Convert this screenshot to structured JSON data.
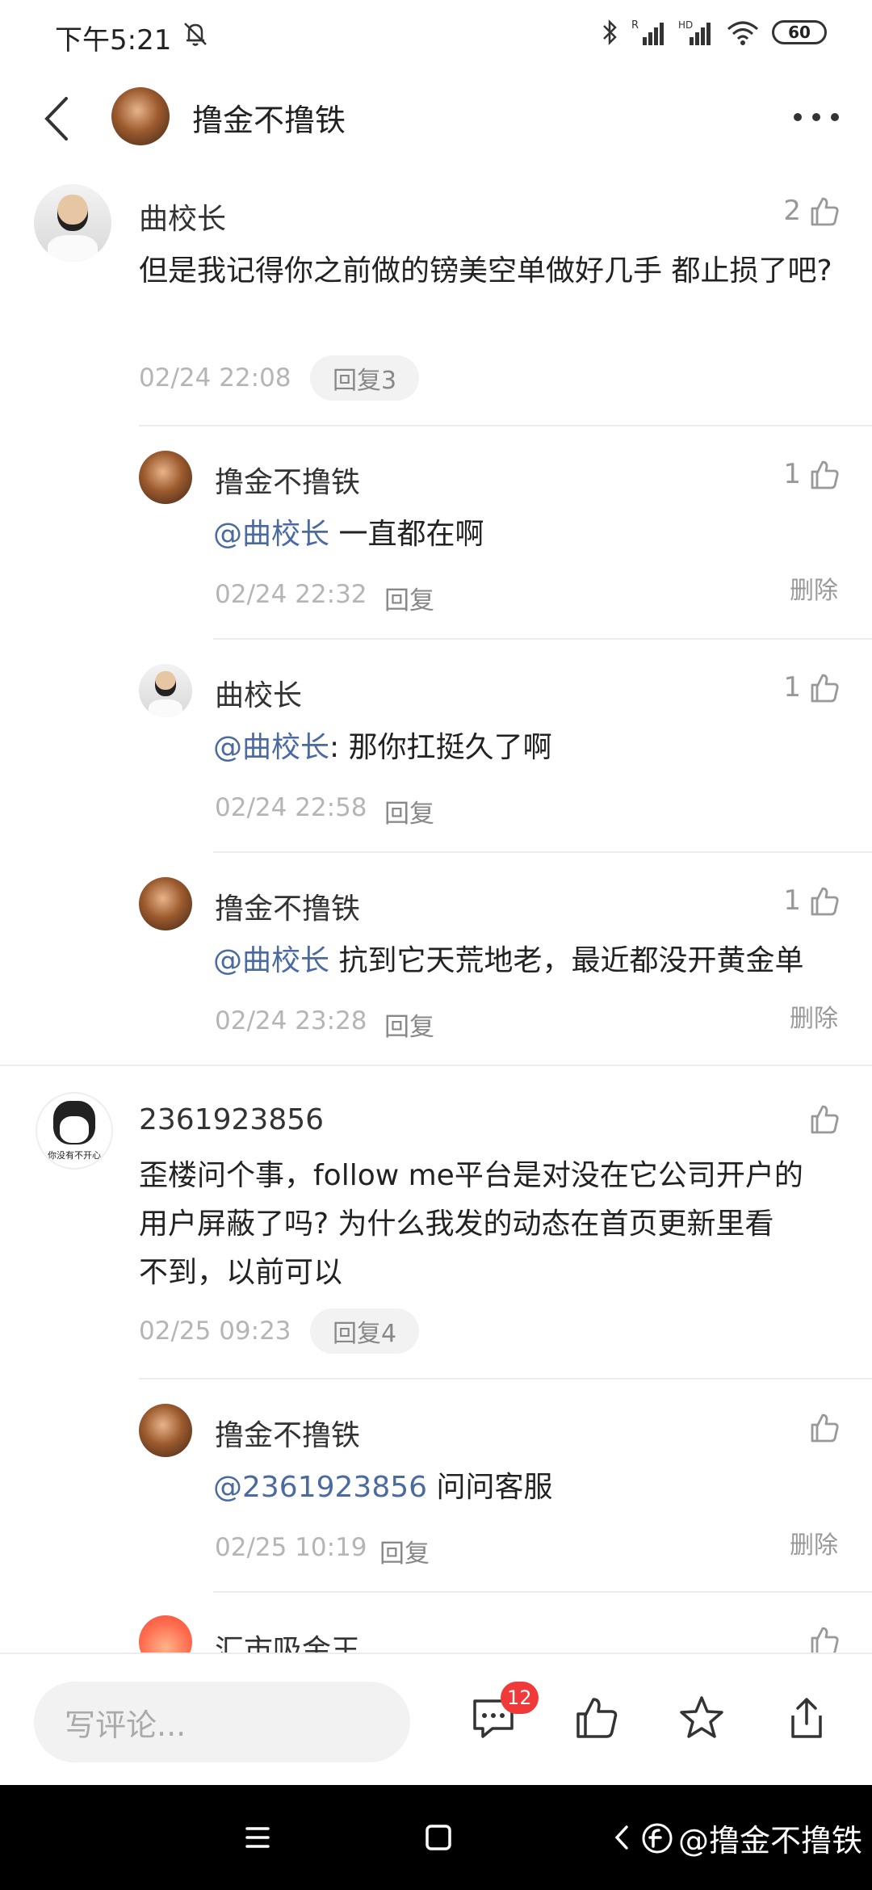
{
  "status_bar": {
    "time": "下午5:21",
    "battery": "60"
  },
  "header": {
    "title": "撸金不撸铁"
  },
  "comments": [
    {
      "name": "曲校长",
      "likes": "2",
      "text": "但是我记得你之前做的镑美空单做好几手 都止损了吧?",
      "time": "02/24 22:08",
      "reply_pill": "回复3",
      "replies": [
        {
          "name": "撸金不撸铁",
          "likes": "1",
          "mention": "@曲校长",
          "text": " 一直都在啊",
          "time": "02/24 22:32",
          "reply": "回复",
          "delete": "删除"
        },
        {
          "name": "曲校长",
          "likes": "1",
          "mention": "@曲校长",
          "text": ": 那你扛挺久了啊",
          "time": "02/24 22:58",
          "reply": "回复"
        },
        {
          "name": "撸金不撸铁",
          "likes": "1",
          "mention": "@曲校长",
          "text": " 抗到它天荒地老，最近都没开黄金单",
          "time": "02/24 23:28",
          "reply": "回复",
          "delete": "删除"
        }
      ]
    },
    {
      "name": "2361923856",
      "likes": "",
      "avatar_text": "你没有不开心",
      "text_lines": [
        "歪楼问个事，follow me平台是对没在它公司开户的",
        "用户屏蔽了吗? 为什么我发的动态在首页更新里看",
        "不到，以前可以"
      ],
      "time": "02/25 09:23",
      "reply_pill": "回复4",
      "replies": [
        {
          "name": "撸金不撸铁",
          "likes": "",
          "mention": "@2361923856",
          "text": " 问问客服",
          "time": "02/25 10:19",
          "reply": "回复",
          "delete": "删除"
        },
        {
          "name": "汇市吸金王",
          "likes": ""
        }
      ]
    }
  ],
  "bottom_bar": {
    "placeholder": "写评论...",
    "comment_count": "12"
  },
  "watermark": "@撸金不撸铁"
}
